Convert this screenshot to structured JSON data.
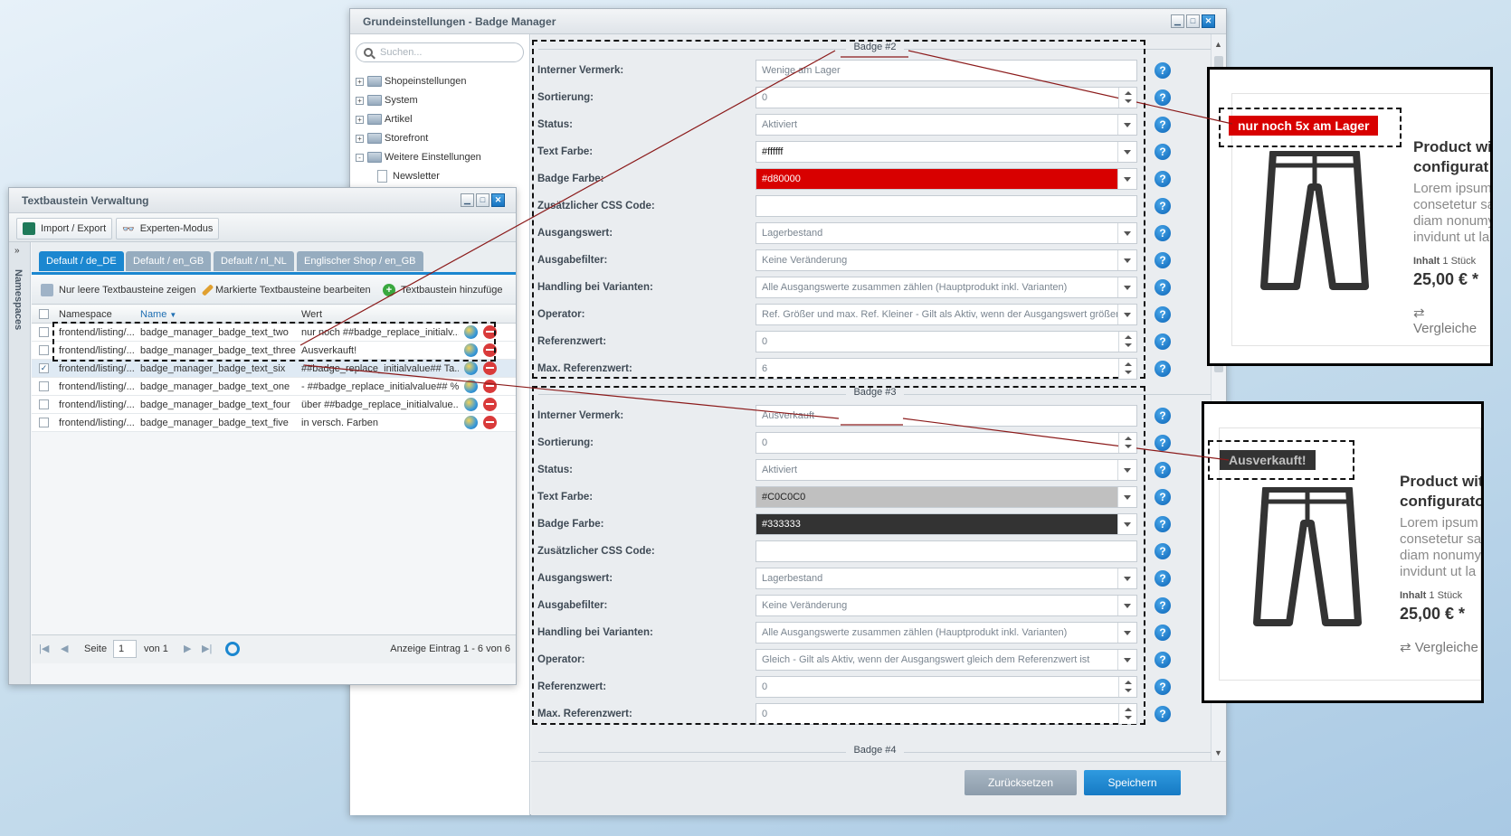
{
  "main_window": {
    "title": "Grundeinstellungen - Badge Manager",
    "search_placeholder": "Suchen...",
    "tree": [
      {
        "label": "Shopeinstellungen",
        "expand": "+"
      },
      {
        "label": "System",
        "expand": "+"
      },
      {
        "label": "Artikel",
        "expand": "+"
      },
      {
        "label": "Storefront",
        "expand": "+"
      },
      {
        "label": "Weitere Einstellungen",
        "expand": "-"
      },
      {
        "label": "Newsletter",
        "expand": ""
      }
    ],
    "buttons": {
      "reset": "Zurücksetzen",
      "save": "Speichern"
    },
    "next_legend": "Badge #4"
  },
  "labels": {
    "note": "Interner Vermerk:",
    "sort": "Sortierung:",
    "status": "Status:",
    "text_color": "Text Farbe:",
    "badge_color": "Badge Farbe:",
    "css": "Zusätzlicher CSS Code:",
    "source": "Ausgangswert:",
    "filter": "Ausgabefilter:",
    "variants": "Handling bei Varianten:",
    "operator": "Operator:",
    "ref": "Referenzwert:",
    "max_ref": "Max. Referenzwert:",
    "help": "?"
  },
  "badge2": {
    "legend": "Badge #2",
    "note": "Wenige am Lager",
    "sort": "0",
    "status": "Aktiviert",
    "text_color": "#ffffff",
    "badge_color": "#d80000",
    "css": "",
    "source": "Lagerbestand",
    "filter": "Keine Veränderung",
    "variants": "Alle Ausgangswerte zusammen zählen (Hauptprodukt inkl. Varianten)",
    "operator": "Ref. Größer und max. Ref. Kleiner - Gilt als Aktiv, wenn der Ausgangswert größer als",
    "ref": "0",
    "max_ref": "6"
  },
  "badge3": {
    "legend": "Badge #3",
    "note": "Ausverkauft",
    "sort": "0",
    "status": "Aktiviert",
    "text_color": "#C0C0C0",
    "badge_color": "#333333",
    "css": "",
    "source": "Lagerbestand",
    "filter": "Keine Veränderung",
    "variants": "Alle Ausgangswerte zusammen zählen (Hauptprodukt inkl. Varianten)",
    "operator": "Gleich - Gilt als Aktiv, wenn der Ausgangswert gleich dem Referenzwert ist",
    "ref": "0",
    "max_ref": "0"
  },
  "text_window": {
    "title": "Textbaustein Verwaltung",
    "import_export": "Import / Export",
    "expert_mode": "Experten-Modus",
    "side_label": "Namespaces",
    "tabs": [
      "Default / de_DE",
      "Default / en_GB",
      "Default / nl_NL",
      "Englischer Shop / en_GB"
    ],
    "tool_empty": "Nur leere Textbausteine zeigen",
    "tool_edit": "Markierte Textbausteine bearbeiten",
    "tool_add": "Textbaustein hinzufüge",
    "col_namespace": "Namespace",
    "col_name": "Name",
    "col_value": "Wert",
    "rows": [
      {
        "ns": "frontend/listing/...",
        "name": "badge_manager_badge_text_two",
        "value": "nur noch ##badge_replace_initialv...",
        "checked": ""
      },
      {
        "ns": "frontend/listing/...",
        "name": "badge_manager_badge_text_three",
        "value": "Ausverkauft!",
        "checked": ""
      },
      {
        "ns": "frontend/listing/...",
        "name": "badge_manager_badge_text_six",
        "value": "##badge_replace_initialvalue## Ta...",
        "checked": "✓"
      },
      {
        "ns": "frontend/listing/...",
        "name": "badge_manager_badge_text_one",
        "value": "- ##badge_replace_initialvalue## %",
        "checked": ""
      },
      {
        "ns": "frontend/listing/...",
        "name": "badge_manager_badge_text_four",
        "value": "über ##badge_replace_initialvalue...",
        "checked": ""
      },
      {
        "ns": "frontend/listing/...",
        "name": "badge_manager_badge_text_five",
        "value": "in versch. Farben",
        "checked": ""
      }
    ],
    "page_label": "Seite",
    "page_value": "1",
    "page_of": "von 1",
    "entries": "Anzeige Eintrag 1 - 6 von 6"
  },
  "product1": {
    "badge": "nur noch 5x am Lager",
    "title1": "Product wi",
    "title2": "configurat",
    "desc": [
      "Lorem ipsum",
      "consetetur sa",
      "diam nonumy",
      "invidunt ut la"
    ],
    "inhalt_label": "Inhalt",
    "inhalt_value": "1 Stück",
    "price": "25,00 € *",
    "compare": "Vergleiche"
  },
  "product2": {
    "badge": "Ausverkauft!",
    "title1": "Product wit",
    "title2": "configurato",
    "desc": [
      "Lorem ipsum",
      "consetetur sa",
      "diam nonumy",
      "invidunt ut la"
    ],
    "inhalt_label": "Inhalt",
    "inhalt_value": "1 Stück",
    "price": "25,00 € *",
    "compare": "Vergleiche"
  },
  "colors": {
    "accent": "#1b87d0",
    "badge_red": "#d80000",
    "badge_dark": "#333333",
    "line": "#8b1a1a"
  }
}
